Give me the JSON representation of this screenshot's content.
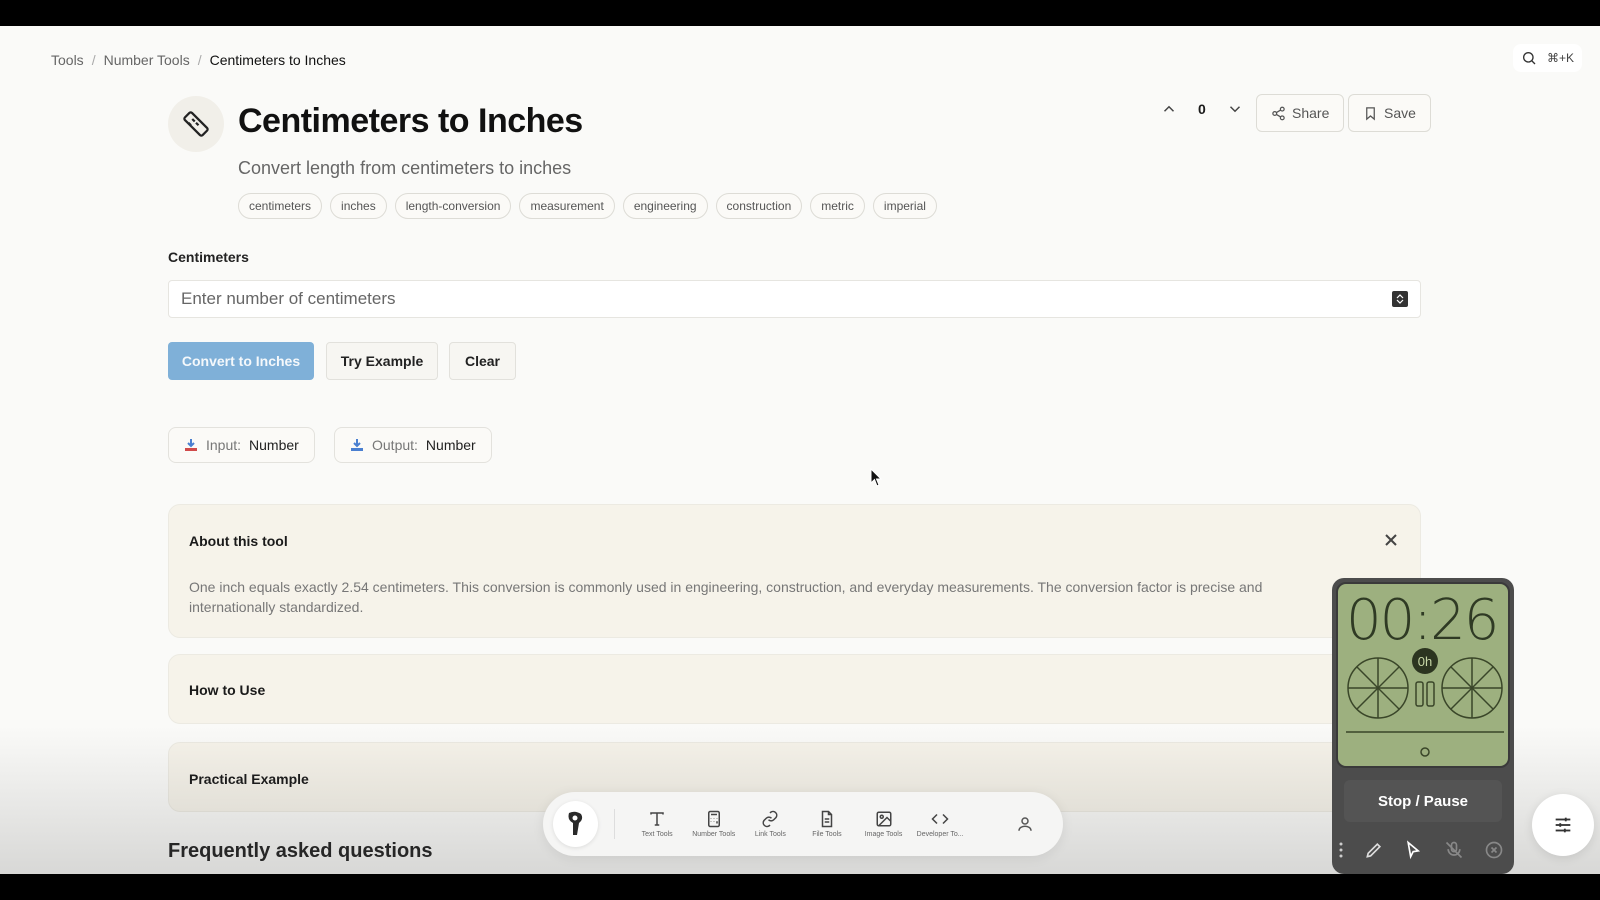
{
  "breadcrumb": {
    "items": [
      "Tools",
      "Number Tools",
      "Centimeters to Inches"
    ],
    "separator": "/"
  },
  "search": {
    "shortcut": "⌘+K",
    "icon": "search-icon"
  },
  "tool": {
    "title": "Centimeters to Inches",
    "subtitle": "Convert length from centimeters to inches",
    "icon": "ruler-icon",
    "tags": [
      "centimeters",
      "inches",
      "length-conversion",
      "measurement",
      "engineering",
      "construction",
      "metric",
      "imperial"
    ]
  },
  "actions": {
    "vote_count": "0",
    "share_label": "Share",
    "save_label": "Save"
  },
  "form": {
    "field_label": "Centimeters",
    "placeholder": "Enter number of centimeters",
    "value": "",
    "convert_label": "Convert to Inches",
    "example_label": "Try Example",
    "clear_label": "Clear"
  },
  "io": {
    "input_label": "Input:",
    "input_value": "Number",
    "output_label": "Output:",
    "output_value": "Number"
  },
  "sections": {
    "about_title": "About this tool",
    "about_text": "One inch equals exactly 2.54 centimeters. This conversion is commonly used in engineering, construction, and everyday measurements. The conversion factor is precise and internationally standardized.",
    "how_title": "How to Use",
    "example_title": "Practical Example",
    "faq_title": "Frequently asked questions"
  },
  "dock": {
    "items": [
      {
        "label": "Text Tools",
        "icon": "text-icon"
      },
      {
        "label": "Number Tools",
        "icon": "calculator-icon"
      },
      {
        "label": "Link Tools",
        "icon": "link-icon"
      },
      {
        "label": "File Tools",
        "icon": "file-icon"
      },
      {
        "label": "Image Tools",
        "icon": "image-icon"
      },
      {
        "label": "Developer To...",
        "icon": "code-icon"
      }
    ]
  },
  "timer": {
    "time": "00:26",
    "badge": "0h",
    "button_label": "Stop / Pause"
  },
  "colors": {
    "primary_button": "#7fb0d8",
    "card_background": "#f6f3ea",
    "timer_screen": "#9db07f"
  }
}
